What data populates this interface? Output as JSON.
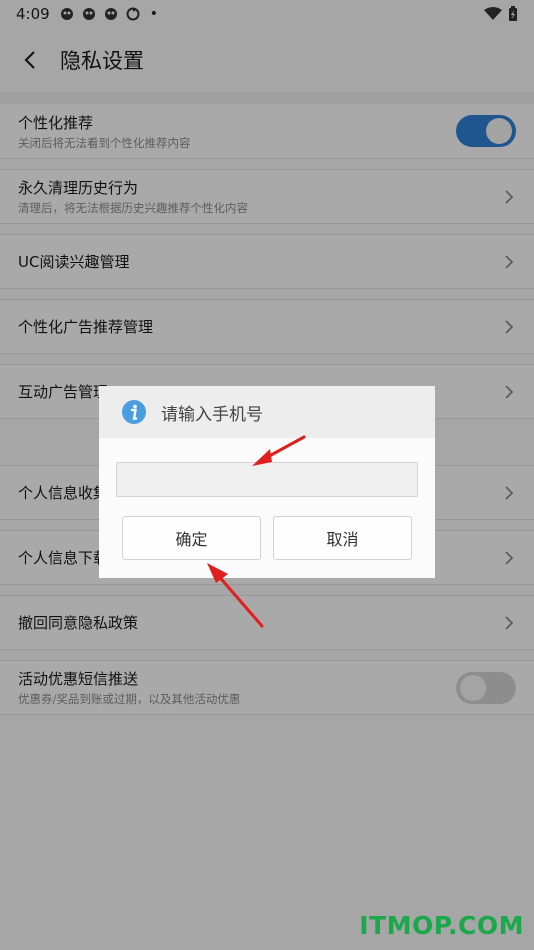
{
  "status_bar": {
    "time": "4:09",
    "notif_icons": [
      "app-notification-icon",
      "app-notification-icon",
      "app-notification-icon",
      "sync-icon"
    ],
    "dot": "•",
    "right_icons": [
      "wifi-icon",
      "battery-charging-icon"
    ]
  },
  "header": {
    "back_icon": "chevron-left-icon",
    "title": "隐私设置"
  },
  "settings": [
    {
      "label": "个性化推荐",
      "sub": "关闭后将无法看到个性化推荐内容",
      "control": "toggle",
      "state": "on"
    },
    {
      "label": "永久清理历史行为",
      "sub": "清理后，将无法根据历史兴趣推荐个性化内容",
      "control": "chevron"
    },
    {
      "label": "UC阅读兴趣管理",
      "sub": "",
      "control": "chevron"
    },
    {
      "label": "个性化广告推荐管理",
      "sub": "",
      "control": "chevron"
    },
    {
      "label": "互动广告管理",
      "sub": "",
      "control": "chevron"
    },
    {
      "label": "个人信息收集清单",
      "sub": "",
      "control": "chevron"
    },
    {
      "label": "个人信息下载",
      "sub": "",
      "control": "chevron"
    },
    {
      "label": "撤回同意隐私政策",
      "sub": "",
      "control": "chevron"
    },
    {
      "label": "活动优惠短信推送",
      "sub": "优惠券/奖品到账或过期，以及其他活动优惠",
      "control": "toggle",
      "state": "off"
    }
  ],
  "dialog": {
    "icon": "info-icon",
    "title": "请输入手机号",
    "input_value": "",
    "input_placeholder": "",
    "ok_label": "确定",
    "cancel_label": "取消"
  },
  "colors": {
    "toggle_on": "#2f7fd4",
    "info_icon": "#4a9ee0",
    "arrow": "#e0201e",
    "watermark": "#1aa84a"
  },
  "watermark": "ITMOP.COM"
}
